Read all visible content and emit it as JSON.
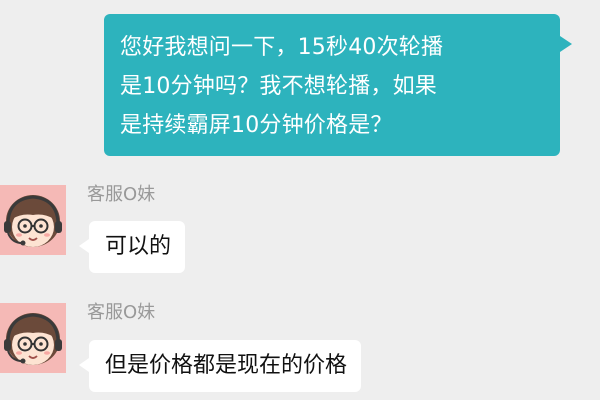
{
  "conversation": {
    "outgoing": {
      "lines": [
        "您好我想问一下，15秒40次轮播",
        "是10分钟吗？我不想轮播，如果",
        "是持续霸屏10分钟价格是？"
      ]
    },
    "incoming": [
      {
        "sender": "客服O妹",
        "text": "可以的"
      },
      {
        "sender": "客服O妹",
        "text": "但是价格都是现在的价格"
      }
    ]
  },
  "colors": {
    "background": "#eeeeee",
    "outgoing_bubble": "#2db3bd",
    "incoming_bubble": "#ffffff",
    "avatar_bg": "#f5b9b6",
    "sender_text": "#999999"
  },
  "icons": {
    "avatar": "cartoon-girl-with-glasses-headset-avatar-icon"
  }
}
